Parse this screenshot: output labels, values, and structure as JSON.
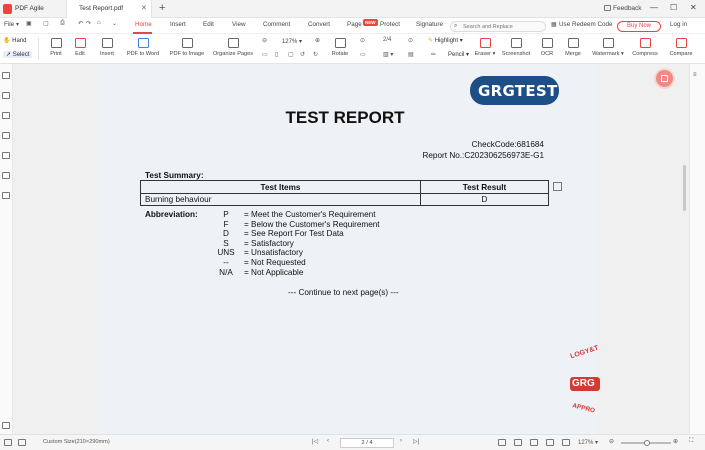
{
  "titlebar": {
    "app_name": "PDF Agile",
    "tab_title": "Test Report.pdf",
    "feedback": "Feedback"
  },
  "menu": {
    "file": "File",
    "items": [
      "Home",
      "Insert",
      "Edit",
      "View",
      "Comment",
      "Convert",
      "Page",
      "Protect",
      "Signature"
    ],
    "active": "Home",
    "new_badge": "NEW",
    "search_placeholder": "Search and Replace",
    "redeem": "Use Redeem Code",
    "buy_now": "Buy Now",
    "login": "Log in"
  },
  "toolbar": {
    "hand": "Hand",
    "select": "Select",
    "print": "Print",
    "edit": "Edit",
    "insert": "Insert",
    "pdf_to_word": "PDF to Word",
    "pdf_to_image": "PDF to Image",
    "organize_pages": "Organize Pages",
    "zoom": "127%",
    "rotate": "Rotate",
    "page_count": "2/4",
    "highlight": "Highlight",
    "pencil": "Pencil",
    "eraser": "Eraser",
    "screenshot": "Screenshot",
    "ocr": "OCR",
    "merge": "Merge",
    "watermark": "Watermark",
    "compress": "Compress",
    "compare": "Compare"
  },
  "document": {
    "logo_text": "GRGTEST",
    "title": "TEST REPORT",
    "check_code": "CheckCode:681684",
    "report_no": "Report No.:C202306256973E-G1",
    "summary_label": "Test Summary:",
    "table": {
      "headers": [
        "Test Items",
        "Test Result"
      ],
      "rows": [
        [
          "Burning behaviour",
          "D"
        ]
      ]
    },
    "abbreviation_label": "Abbreviation:",
    "abbreviations": [
      {
        "code": "P",
        "meaning": "= Meet the Customer's Requirement"
      },
      {
        "code": "F",
        "meaning": "= Below the Customer's Requirement"
      },
      {
        "code": "D",
        "meaning": "= See Report For Test Data"
      },
      {
        "code": "S",
        "meaning": "= Satisfactory"
      },
      {
        "code": "UNS",
        "meaning": "= Unsatisfactory"
      },
      {
        "code": "--",
        "meaning": "= Not Requested"
      },
      {
        "code": "N/A",
        "meaning": "= Not Applicable"
      }
    ],
    "continue_note": "--- Continue to next page(s) ---",
    "stamp_texts": [
      "LOGY&T",
      "GRG",
      "APPRO"
    ]
  },
  "statusbar": {
    "page_size": "Custom Size(210×290mm)",
    "page_indicator": "2 / 4",
    "zoom": "127%"
  },
  "colors": {
    "accent": "#e8473f",
    "logo_bg": "#1d4f86",
    "page_bg": "#eef2f7"
  }
}
